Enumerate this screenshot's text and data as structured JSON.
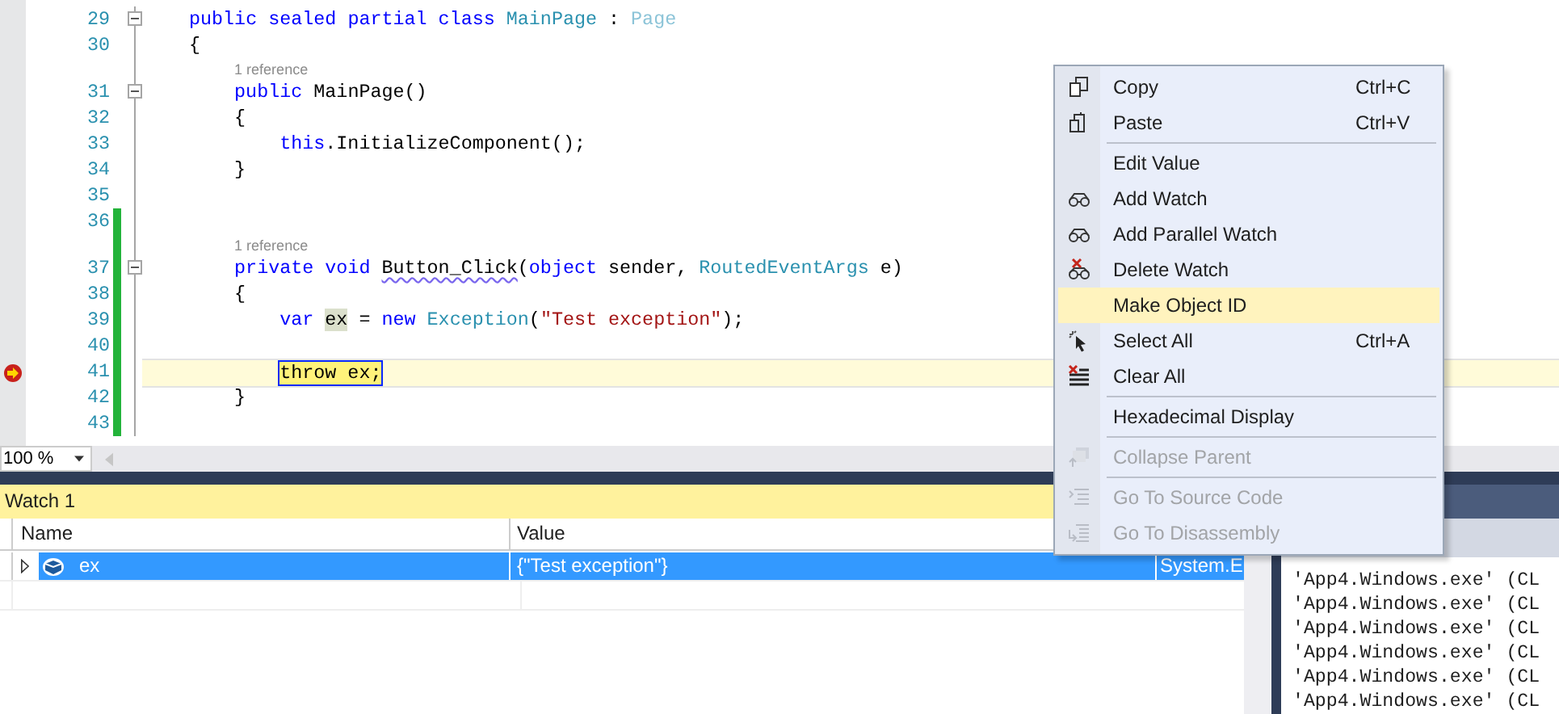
{
  "editor": {
    "lines": [
      {
        "kind": "code",
        "number": "29",
        "collapsible": true,
        "changed": false,
        "current": false,
        "execution_point": false,
        "tokens": [
          {
            "text": "public sealed partial class ",
            "kind": "keyword"
          },
          {
            "text": "MainPage",
            "kind": "type"
          },
          {
            "text": " : ",
            "kind": "plain"
          },
          {
            "text": "Page",
            "kind": "type-faded"
          }
        ]
      },
      {
        "kind": "code",
        "number": "30",
        "collapsible": false,
        "changed": false,
        "current": false,
        "execution_point": false,
        "tokens": [
          {
            "text": "{",
            "kind": "plain"
          }
        ]
      },
      {
        "kind": "codelens",
        "changed": false,
        "text": "1 reference"
      },
      {
        "kind": "code",
        "number": "31",
        "collapsible": true,
        "changed": false,
        "current": false,
        "execution_point": false,
        "tokens": [
          {
            "text": "    public",
            "kind": "keyword"
          },
          {
            "text": " MainPage()",
            "kind": "plain"
          }
        ]
      },
      {
        "kind": "code",
        "number": "32",
        "collapsible": false,
        "changed": false,
        "current": false,
        "execution_point": false,
        "tokens": [
          {
            "text": "    {",
            "kind": "plain"
          }
        ]
      },
      {
        "kind": "code",
        "number": "33",
        "collapsible": false,
        "changed": false,
        "current": false,
        "execution_point": false,
        "tokens": [
          {
            "text": "        this",
            "kind": "keyword"
          },
          {
            "text": ".InitializeComponent();",
            "kind": "plain"
          }
        ]
      },
      {
        "kind": "code",
        "number": "34",
        "collapsible": false,
        "changed": false,
        "current": false,
        "execution_point": false,
        "tokens": [
          {
            "text": "    }",
            "kind": "plain"
          }
        ]
      },
      {
        "kind": "code",
        "number": "35",
        "collapsible": false,
        "changed": false,
        "current": false,
        "execution_point": false
      },
      {
        "kind": "code",
        "number": "36",
        "collapsible": false,
        "changed": true,
        "current": false,
        "execution_point": false
      },
      {
        "kind": "codelens",
        "changed": true,
        "text": "1 reference"
      },
      {
        "kind": "code",
        "number": "37",
        "collapsible": true,
        "changed": true,
        "current": false,
        "execution_point": false,
        "tokens": [
          {
            "text": "    private void ",
            "kind": "keyword"
          },
          {
            "text": "Button_Click",
            "kind": "squiggle"
          },
          {
            "text": "(",
            "kind": "plain"
          },
          {
            "text": "object",
            "kind": "keyword"
          },
          {
            "text": " sender, ",
            "kind": "plain"
          },
          {
            "text": "RoutedEventArgs",
            "kind": "type"
          },
          {
            "text": " e)",
            "kind": "plain"
          }
        ]
      },
      {
        "kind": "code",
        "number": "38",
        "collapsible": false,
        "changed": true,
        "current": false,
        "execution_point": false,
        "tokens": [
          {
            "text": "    {",
            "kind": "plain"
          }
        ]
      },
      {
        "kind": "code",
        "number": "39",
        "collapsible": false,
        "changed": true,
        "current": false,
        "execution_point": false,
        "tokens": [
          {
            "text": "        var ",
            "kind": "keyword"
          },
          {
            "text": "ex",
            "kind": "reference"
          },
          {
            "text": " = ",
            "kind": "plain"
          },
          {
            "text": "new ",
            "kind": "keyword"
          },
          {
            "text": "Exception",
            "kind": "type"
          },
          {
            "text": "(",
            "kind": "plain"
          },
          {
            "text": "\"Test exception\"",
            "kind": "string"
          },
          {
            "text": ");",
            "kind": "plain"
          }
        ]
      },
      {
        "kind": "code",
        "number": "40",
        "collapsible": false,
        "changed": true,
        "current": false,
        "execution_point": false
      },
      {
        "kind": "code",
        "number": "41",
        "collapsible": false,
        "changed": true,
        "current": true,
        "execution_point": true,
        "tokens": [
          {
            "text": "        throw ex;",
            "kind": "statement"
          }
        ]
      },
      {
        "kind": "code",
        "number": "42",
        "collapsible": false,
        "changed": true,
        "current": false,
        "execution_point": false,
        "tokens": [
          {
            "text": "    }",
            "kind": "plain"
          }
        ]
      },
      {
        "kind": "code",
        "number": "43",
        "collapsible": false,
        "changed": true,
        "current": false,
        "execution_point": false
      }
    ]
  },
  "editor_bar": {
    "zoom": "100 %"
  },
  "watch": {
    "title": "Watch 1",
    "columns": [
      "Name",
      "Value"
    ],
    "rows": [
      {
        "name": "ex",
        "value": "{\"Test exception\"}",
        "column_3": "System.E",
        "selected": true,
        "expanded": false
      }
    ]
  },
  "context_menu": {
    "items": [
      {
        "kind": "item",
        "label": "Copy",
        "shortcut": "Ctrl+C",
        "highlighted": false,
        "disabled": false
      },
      {
        "kind": "item",
        "label": "Paste",
        "shortcut": "Ctrl+V",
        "highlighted": false,
        "disabled": false
      },
      {
        "kind": "separator"
      },
      {
        "kind": "item",
        "label": "Edit Value",
        "highlighted": false,
        "disabled": false
      },
      {
        "kind": "item",
        "label": "Add Watch",
        "highlighted": false,
        "disabled": false
      },
      {
        "kind": "item",
        "label": "Add Parallel Watch",
        "highlighted": false,
        "disabled": false
      },
      {
        "kind": "item",
        "label": "Delete Watch",
        "highlighted": false,
        "disabled": false
      },
      {
        "kind": "item",
        "label": "Make Object ID",
        "highlighted": true,
        "disabled": false
      },
      {
        "kind": "item",
        "label": "Select All",
        "shortcut": "Ctrl+A",
        "highlighted": false,
        "disabled": false
      },
      {
        "kind": "item",
        "label": "Clear All",
        "highlighted": false,
        "disabled": false
      },
      {
        "kind": "separator"
      },
      {
        "kind": "item",
        "label": "Hexadecimal Display",
        "highlighted": false,
        "disabled": false
      },
      {
        "kind": "separator"
      },
      {
        "kind": "item",
        "label": "Collapse Parent",
        "highlighted": false,
        "disabled": true
      },
      {
        "kind": "separator"
      },
      {
        "kind": "item",
        "label": "Go To Source Code",
        "highlighted": false,
        "disabled": true
      },
      {
        "kind": "item",
        "label": "Go To Disassembly",
        "highlighted": false,
        "disabled": true
      }
    ]
  },
  "output": {
    "lines": [
      "'App4.Windows.exe' (CL",
      "'App4.Windows.exe' (CL",
      "'App4.Windows.exe' (CL",
      "'App4.Windows.exe' (CL",
      "'App4.Windows.exe' (CL",
      "'App4.Windows.exe' (CL"
    ]
  }
}
